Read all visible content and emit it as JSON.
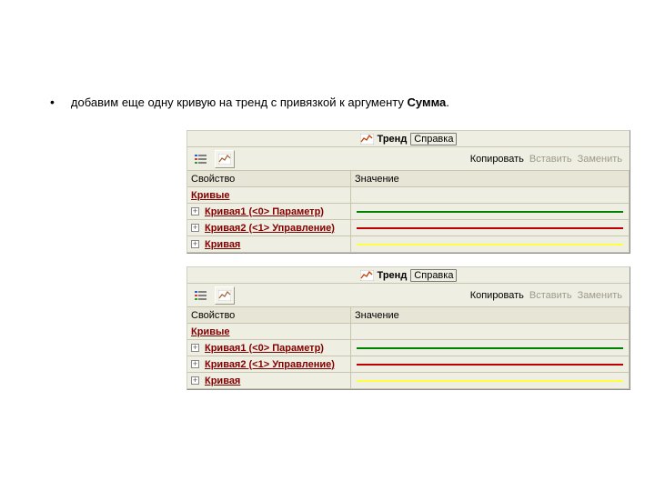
{
  "doc": {
    "bullet_prefix": "добавим еще одну кривую на тренд с привязкой к аргументу ",
    "bullet_bold": "Сумма",
    "bullet_suffix": "."
  },
  "panel": {
    "title_label": "Тренд",
    "help_label": "Справка",
    "actions": {
      "copy": "Копировать",
      "paste": "Вставить",
      "replace": "Заменить"
    },
    "headers": {
      "prop": "Свойство",
      "value": "Значение"
    },
    "section_label": "Кривые",
    "rows": [
      {
        "label": "Кривая1 (<0> Параметр)",
        "color": "#008000"
      },
      {
        "label": "Кривая2 (<1> Управление)",
        "color": "#c00000"
      },
      {
        "label": "Кривая",
        "color": "#ffff40"
      }
    ]
  }
}
